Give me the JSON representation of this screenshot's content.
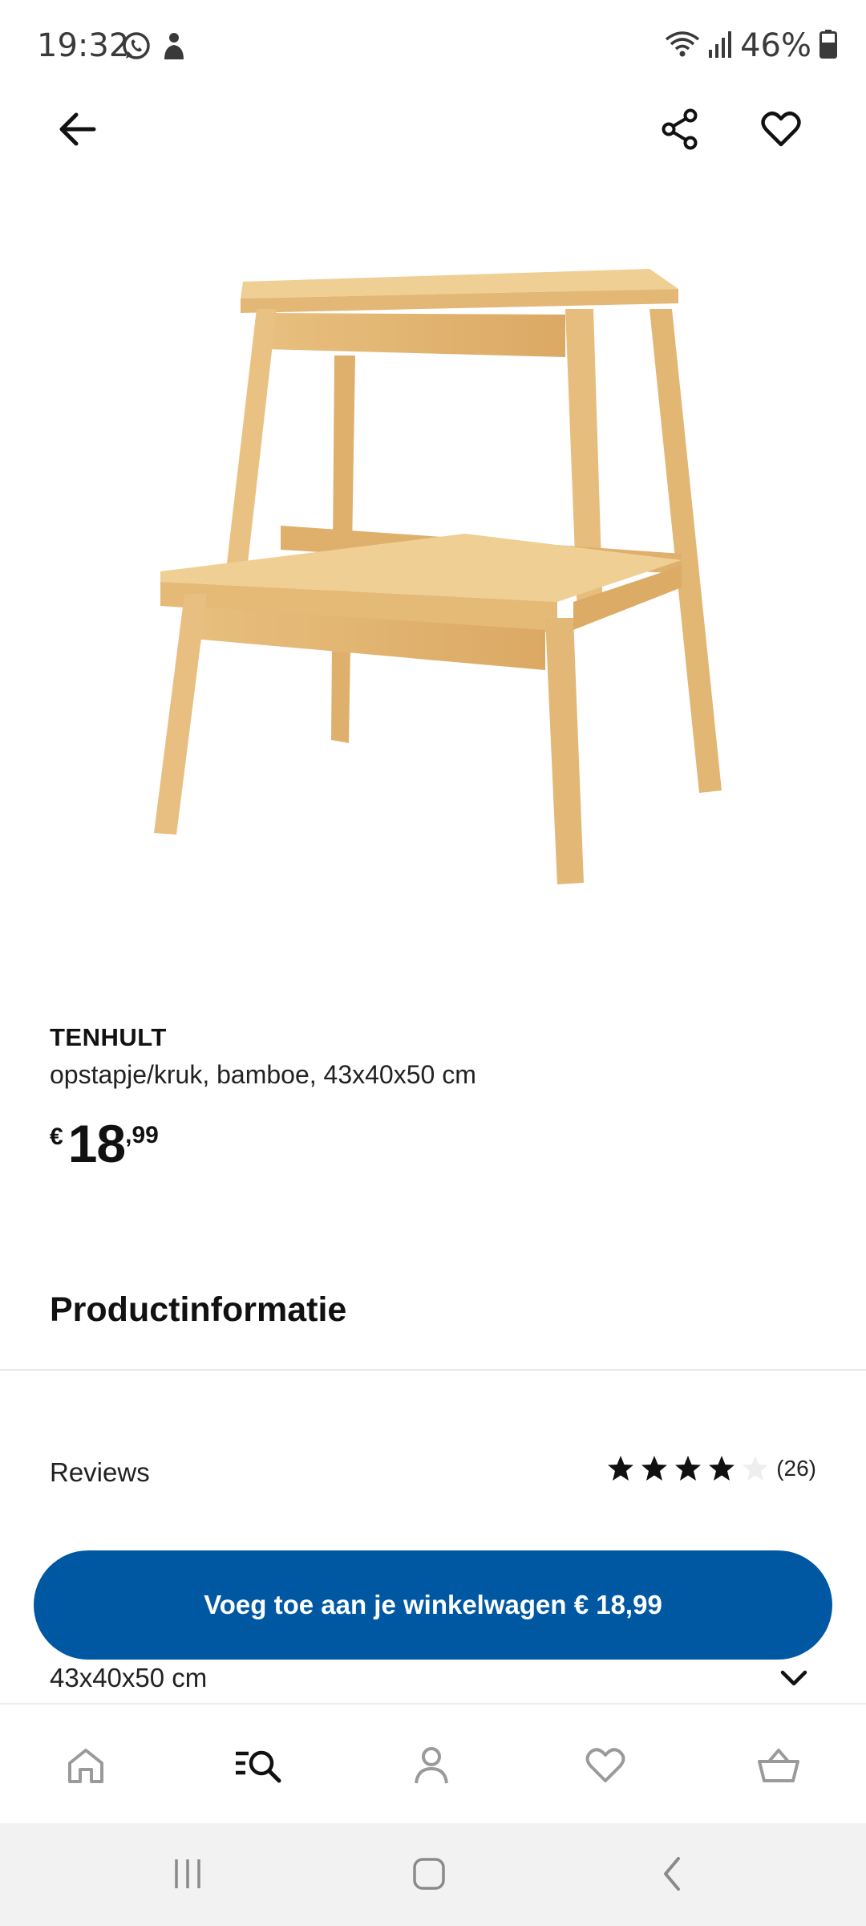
{
  "status_bar": {
    "time": "19:32",
    "battery": "46%",
    "icons": [
      "whatsapp-icon",
      "notification-icon",
      "wifi-icon",
      "signal-icon",
      "battery-icon"
    ]
  },
  "app_bar": {
    "icons": [
      "back-arrow-icon",
      "share-icon",
      "heart-icon"
    ]
  },
  "product": {
    "name": "TENHULT",
    "description": "opstapje/kruk, bamboe, 43x40x50 cm",
    "price_currency": "€",
    "price_main": "18",
    "price_decimals": ",99"
  },
  "sections": {
    "info_title": "Productinformatie",
    "reviews_label": "Reviews",
    "reviews_rating": 4,
    "reviews_max": 5,
    "reviews_count": "(26)",
    "size_label": "43x40x50 cm"
  },
  "cta": {
    "label": "Voeg toe aan je winkelwagen € 18,99",
    "color": "#0058a3"
  },
  "bottom_nav": {
    "items": [
      "home-icon",
      "search-icon",
      "profile-icon",
      "favorites-icon",
      "cart-icon"
    ],
    "active": "search-icon"
  },
  "system_nav": {
    "items": [
      "recent-apps-icon",
      "home-button-icon",
      "back-icon"
    ]
  }
}
